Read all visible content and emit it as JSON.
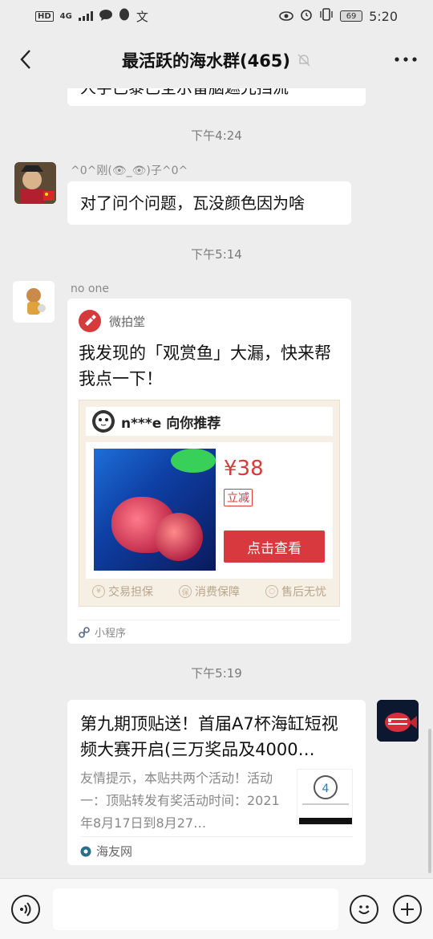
{
  "status_bar": {
    "hd": "HD",
    "network": "4G",
    "battery": "69",
    "time": "5:20"
  },
  "header": {
    "title": "最活跃的海水群(465)"
  },
  "messages": {
    "top_partial_text": "人字已黎已全示留脑遮光挡流",
    "t1": "下午4:24",
    "m1_nick": "^0^刚(👁_👁)子^0^",
    "m1_text": "对了问个问题，瓦没颜色因为啥",
    "t2": "下午5:14",
    "m2_nick": "no one",
    "t3": "下午5:19"
  },
  "miniprogram": {
    "app_name": "微拍堂",
    "title": "我发现的「观赏鱼」大漏，快来帮我点一下！",
    "recommender": "n***e 向你推荐",
    "price": "¥38",
    "tag": "立减",
    "button": "点击查看",
    "guarantees": [
      "交易担保",
      "消费保障",
      "售后无忧"
    ],
    "footer": "小程序"
  },
  "article": {
    "title": "第九期顶贴送！首届A7杯海缸短视频大赛开启(三万奖品及4000…",
    "desc": "友情提示，本贴共两个活动！活动一：顶贴转发有奖活动时间：2021年8月17日到8月27…",
    "source": "海友网"
  },
  "colors": {
    "accent_red": "#d8393e",
    "bg": "#ededed"
  },
  "icons": [
    "back-arrow-icon",
    "mute-bell-icon",
    "more-icon",
    "voice-icon",
    "emoji-icon",
    "plus-icon"
  ]
}
